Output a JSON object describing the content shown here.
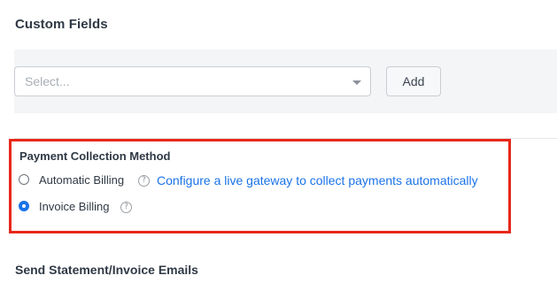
{
  "custom_fields": {
    "title": "Custom Fields",
    "select_placeholder": "Select...",
    "add_label": "Add"
  },
  "payment": {
    "title": "Payment Collection Method",
    "options": [
      {
        "label": "Automatic Billing",
        "checked": false
      },
      {
        "label": "Invoice Billing",
        "checked": true
      }
    ],
    "configure_link": "Configure a live gateway to collect payments automatically",
    "help_glyph": "?"
  },
  "statement": {
    "title": "Send Statement/Invoice Emails"
  },
  "colors": {
    "highlight": "#e8281a",
    "link": "#1a73e8",
    "panel_bg": "#f4f5f7"
  },
  "icons": [
    "chevron-down-icon",
    "help-icon"
  ]
}
